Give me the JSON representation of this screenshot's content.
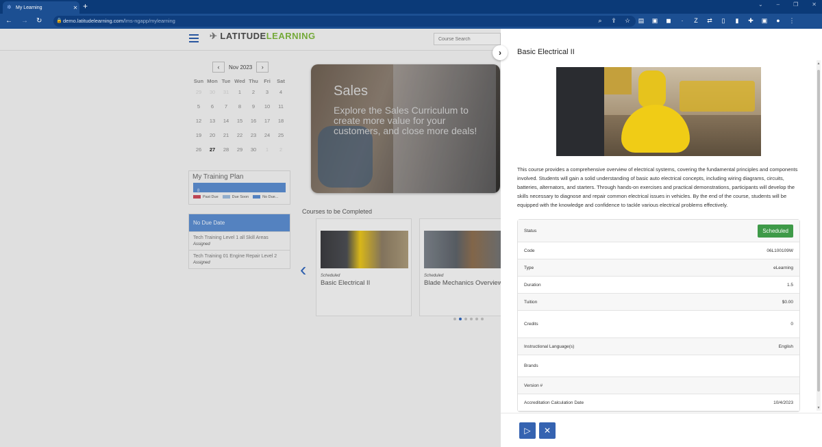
{
  "browser": {
    "tab_title": "My Learning",
    "new_tab": "+",
    "url_host": "demo.latitudelearning.com",
    "url_path": "/lms-ngapp/mylearning"
  },
  "app": {
    "logo_text_a": "LATITUDE",
    "logo_text_b": "LEARNING",
    "search_placeholder": "Course Search"
  },
  "calendar": {
    "month_label": "Nov 2023",
    "days_of_week": [
      "Sun",
      "Mon",
      "Tue",
      "Wed",
      "Thu",
      "Fri",
      "Sat"
    ],
    "weeks": [
      [
        "29",
        "30",
        "31",
        "1",
        "2",
        "3",
        "4"
      ],
      [
        "5",
        "6",
        "7",
        "8",
        "9",
        "10",
        "11"
      ],
      [
        "12",
        "13",
        "14",
        "15",
        "16",
        "17",
        "18"
      ],
      [
        "19",
        "20",
        "21",
        "22",
        "23",
        "24",
        "25"
      ],
      [
        "26",
        "27",
        "28",
        "29",
        "30",
        "1",
        "2"
      ]
    ],
    "today": "27"
  },
  "training_plan": {
    "title": "My Training Plan",
    "bar_value": "8",
    "legend": [
      {
        "label": "Past Due",
        "color": "#c94a5a"
      },
      {
        "label": "Due Soon",
        "color": "#9bb8d8"
      },
      {
        "label": "No Due...",
        "color": "#5a8bcc"
      }
    ]
  },
  "no_due_date": {
    "title": "No Due Date",
    "items": [
      {
        "name": "Tech Training Level 1 all Skill Areas",
        "status": "Assigned"
      },
      {
        "name": "Tech Training 01 Engine Repair Level 2",
        "status": "Assigned"
      }
    ]
  },
  "banner": {
    "title": "Sales",
    "text": "Explore the Sales Curriculum to create more value for your customers, and close more deals!"
  },
  "courses": {
    "label": "Courses to be Completed",
    "cards": [
      {
        "status": "Scheduled",
        "title": "Basic Electrical II"
      },
      {
        "status": "Scheduled",
        "title": "Blade Mechanics Overview"
      }
    ]
  },
  "panel": {
    "title": "Basic Electrical II",
    "description": "This course provides a comprehensive overview of electrical systems, covering the fundamental principles and components involved. Students will gain a solid understanding of basic auto electrical concepts, including wiring diagrams, circuits, batteries, alternators, and starters. Through hands-on exercises and practical demonstrations, participants will develop the skills necessary to diagnose and repair common electrical issues in vehicles. By the end of the course, students will be equipped with the knowledge and confidence to tackle various electrical problems effectively.",
    "properties": [
      {
        "label": "Status",
        "value": "Scheduled"
      },
      {
        "label": "Code",
        "value": "06L100109W"
      },
      {
        "label": "Type",
        "value": "eLearning"
      },
      {
        "label": "Duration",
        "value": "1.5"
      },
      {
        "label": "Tuition",
        "value": "$0.00"
      },
      {
        "label": "Credits",
        "value": "0"
      },
      {
        "label": "Instructional Language(s)",
        "value": "English"
      },
      {
        "label": "Brands",
        "value": ""
      },
      {
        "label": "Version #",
        "value": ""
      },
      {
        "label": "Accreditation Calculation Date",
        "value": "10/4/2023"
      }
    ],
    "launch_icon": "play-icon",
    "close_icon": "close-icon"
  }
}
